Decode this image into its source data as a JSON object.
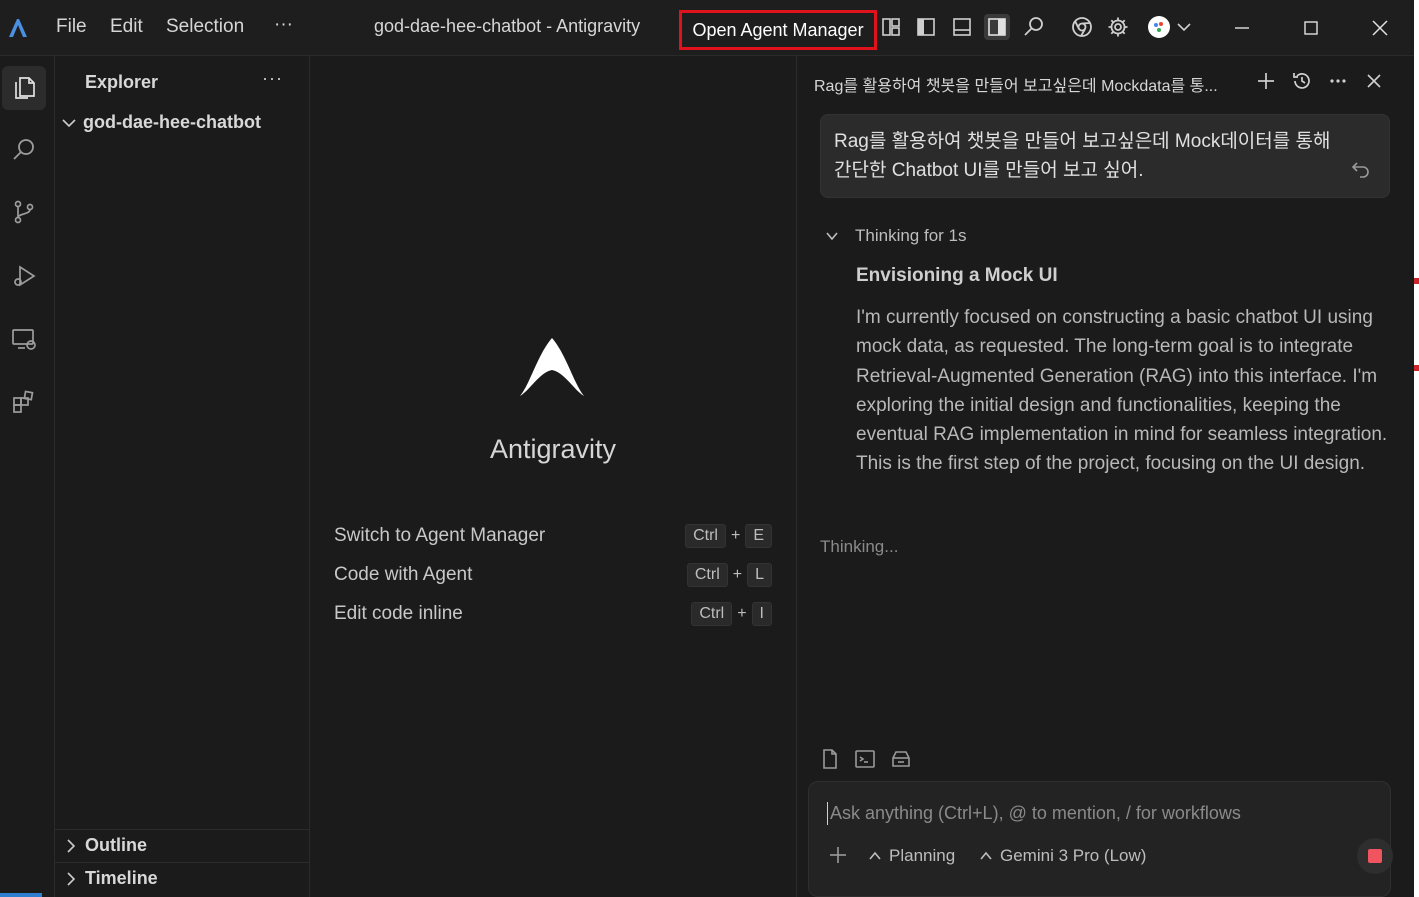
{
  "titlebar": {
    "menu": [
      "File",
      "Edit",
      "Selection",
      "···"
    ],
    "window_title": "god-dae-hee-chatbot - Antigravity",
    "open_agent_manager": "Open Agent Manager"
  },
  "sidebar": {
    "title": "Explorer",
    "more": "···",
    "folder": "god-dae-hee-chatbot",
    "sections": [
      "Outline",
      "Timeline"
    ]
  },
  "editor": {
    "app_name": "Antigravity",
    "shortcuts": [
      {
        "label": "Switch to Agent Manager",
        "mod": "Ctrl",
        "plus": "+",
        "key": "E"
      },
      {
        "label": "Code with Agent",
        "mod": "Ctrl",
        "plus": "+",
        "key": "L"
      },
      {
        "label": "Edit code inline",
        "mod": "Ctrl",
        "plus": "+",
        "key": "I"
      }
    ]
  },
  "agent": {
    "title": "Rag를 활용하여 챗봇을 만들어 보고싶은데 Mockdata를 통...",
    "user_message": "Rag를 활용하여 챗봇을 만들어 보고싶은데 Mock데이터를 통해 간단한 Chatbot UI를 만들어 보고 싶어.",
    "thinking_label": "Thinking for 1s",
    "thinking_heading": "Envisioning a Mock UI",
    "thinking_body": "I'm currently focused on constructing a basic chatbot UI using mock data, as requested. The long-term goal is to integrate Retrieval-Augmented Generation (RAG) into this interface. I'm exploring the initial design and functionalities, keeping the eventual RAG implementation in mind for seamless integration. This is the first step of the project, focusing on the UI design.",
    "status": "Thinking...",
    "input_placeholder": "Ask anything (Ctrl+L), @ to mention, / for workflows",
    "mode": "Planning",
    "model": "Gemini 3 Pro (Low)"
  },
  "colors": {
    "highlight_border": "#e0121b",
    "stop": "#f0545e",
    "background": "#1b1b1b"
  }
}
